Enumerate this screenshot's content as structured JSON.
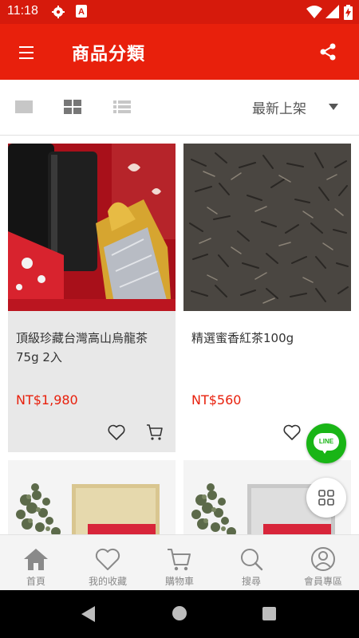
{
  "status_bar": {
    "time": "11:18",
    "icons": [
      "gear-icon",
      "accessibility-a-icon",
      "wifi-icon",
      "signal-icon",
      "battery-charging-icon"
    ]
  },
  "app_bar": {
    "title": "商品分類",
    "menu_icon": "hamburger-menu-icon",
    "share_icon": "share-icon",
    "background_color": "#e8200c"
  },
  "toolbar": {
    "view_modes": [
      "single-column-icon",
      "two-column-grid-icon",
      "list-icon"
    ],
    "selected_view": "two-column-grid-icon",
    "sort_label": "最新上架"
  },
  "products": [
    {
      "name": "頂級珍藏台灣高山烏龍茶75g 2入",
      "price": "NT$1,980",
      "image": "oolong-gift-box-photo",
      "highlighted": true
    },
    {
      "name": "精選蜜香紅茶100g",
      "price": "NT$560",
      "image": "black-tea-leaves-photo",
      "highlighted": false
    },
    {
      "name": "",
      "price": "",
      "image": "oolong-tea-pack-photo",
      "highlighted": false
    },
    {
      "name": "",
      "price": "",
      "image": "oolong-tea-pack-photo",
      "highlighted": false
    }
  ],
  "fab": {
    "line_label": "LINE",
    "line_color": "#19b516",
    "grid_icon": "grid-menu-icon"
  },
  "bottom_nav": {
    "items": [
      {
        "label": "首頁",
        "icon": "home-icon"
      },
      {
        "label": "我的收藏",
        "icon": "heart-icon"
      },
      {
        "label": "購物車",
        "icon": "cart-icon"
      },
      {
        "label": "搜尋",
        "icon": "search-icon"
      },
      {
        "label": "會員專區",
        "icon": "user-icon"
      }
    ]
  },
  "colors": {
    "accent": "#e8200c",
    "price": "#e8200c",
    "highlight_card_bg": "#e8e8e8"
  }
}
